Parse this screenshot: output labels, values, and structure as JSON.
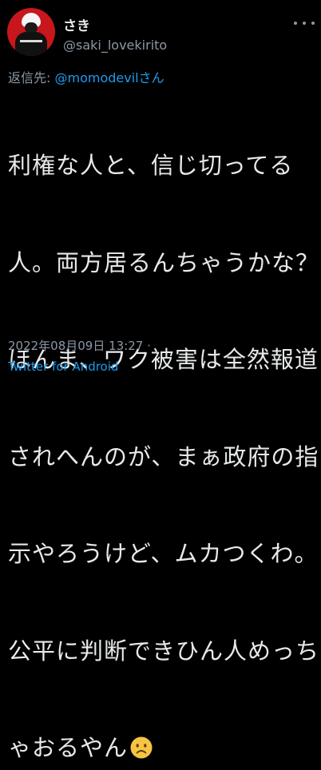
{
  "user": {
    "display_name": "さき",
    "handle": "@saki_lovekirito"
  },
  "reply": {
    "label": "返信先: ",
    "mention": "@momodevilさん"
  },
  "tweet": {
    "lines": [
      "利権な人と、信じ切ってる",
      "人。両方居るんちゃうかな？",
      "ほんま、ワク被害は全然報道",
      "されへんのが、まぁ政府の指",
      "示やろうけど、ムカつくわ。",
      "公平に判断できひん人めっち",
      "ゃおるやん"
    ]
  },
  "meta": {
    "timestamp": "2022年08月09日 13:27 ·",
    "source": "Twitter for Android"
  },
  "icons": {
    "more": "more-options-icon",
    "avatar": "avatar",
    "emoji": "sad-face-emoji-icon"
  },
  "colors": {
    "background": "#000000",
    "text": "#e7e9ea",
    "secondary": "#8b98a5",
    "accent": "#1d9bf0",
    "emoji": "#f6c443"
  }
}
